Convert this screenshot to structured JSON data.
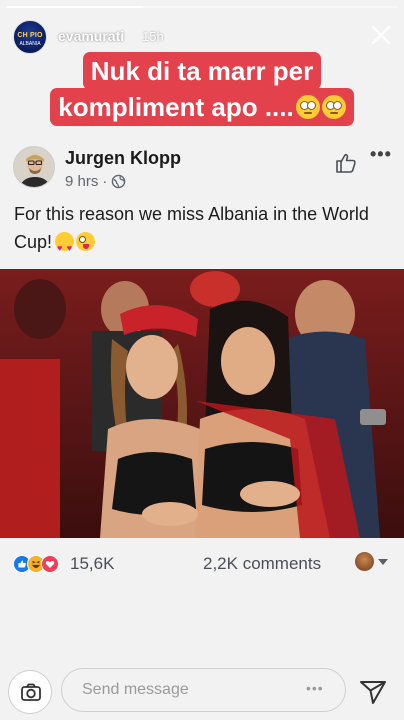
{
  "story": {
    "progress": 0.35,
    "username": "evamurati",
    "timestamp": "15h",
    "avatar_text_top": "CH PIO",
    "avatar_text_bottom": "ALBANIA",
    "caption_line1": "Nuk di ta marr per",
    "caption_line2": "kompliment apo ...."
  },
  "post": {
    "author": "Jurgen Klopp",
    "time": "9 hrs",
    "privacy_icon": "globe-icon",
    "text": "For this reason we miss Albania in the World Cup!",
    "reactions": {
      "icons": [
        "like-icon",
        "haha-icon",
        "love-icon"
      ],
      "count": "15,6K"
    },
    "comments": "2,2K comments"
  },
  "bottom": {
    "message_placeholder": "Send message",
    "camera_icon": "camera-icon",
    "send_icon": "send-icon"
  },
  "colors": {
    "caption_bg": "#e3414c",
    "like_blue": "#1877f2",
    "love_red": "#f33e58",
    "haha_yellow": "#f7b125",
    "background": "#f2f2f2"
  }
}
